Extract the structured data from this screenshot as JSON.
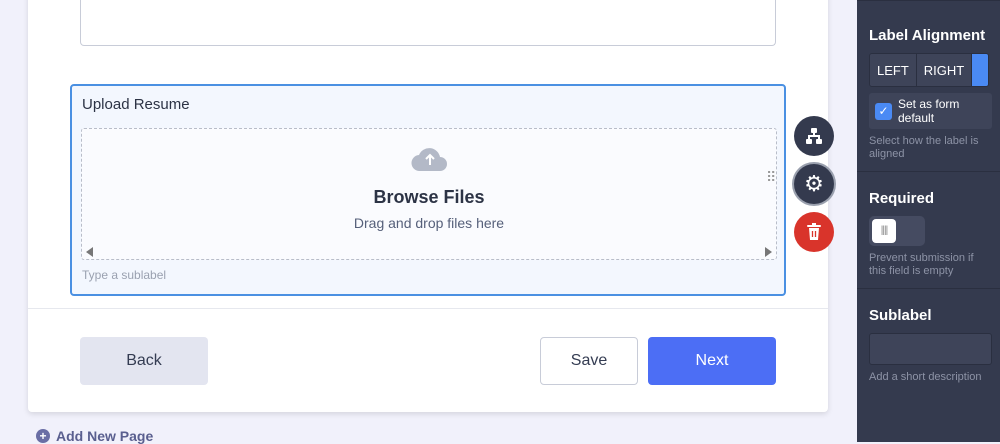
{
  "form": {
    "field_label": "Upload Resume",
    "browse_label": "Browse Files",
    "drag_text": "Drag and drop files here",
    "sublabel_placeholder": "Type a sublabel",
    "back_label": "Back",
    "save_label": "Save",
    "next_label": "Next",
    "add_page_label": "Add New Page"
  },
  "fabs": [
    "hierarchy-icon",
    "gear-icon",
    "trash-icon"
  ],
  "panel": {
    "label_alignment_title": "Label Alignment",
    "align_options": [
      "LEFT",
      "RIGHT"
    ],
    "set_default_label": "Set as form default",
    "set_default_checked": true,
    "label_hint": "Select how the label is aligned",
    "required_title": "Required",
    "required_on": false,
    "required_hint": "Prevent submission if this field is empty",
    "sublabel_title": "Sublabel",
    "sublabel_value": "",
    "sublabel_hint": "Add a short description"
  },
  "colors": {
    "accent": "#4c6ef5",
    "selected_border": "#4a90e2",
    "delete": "#d9342b",
    "panel": "#343a4e"
  }
}
